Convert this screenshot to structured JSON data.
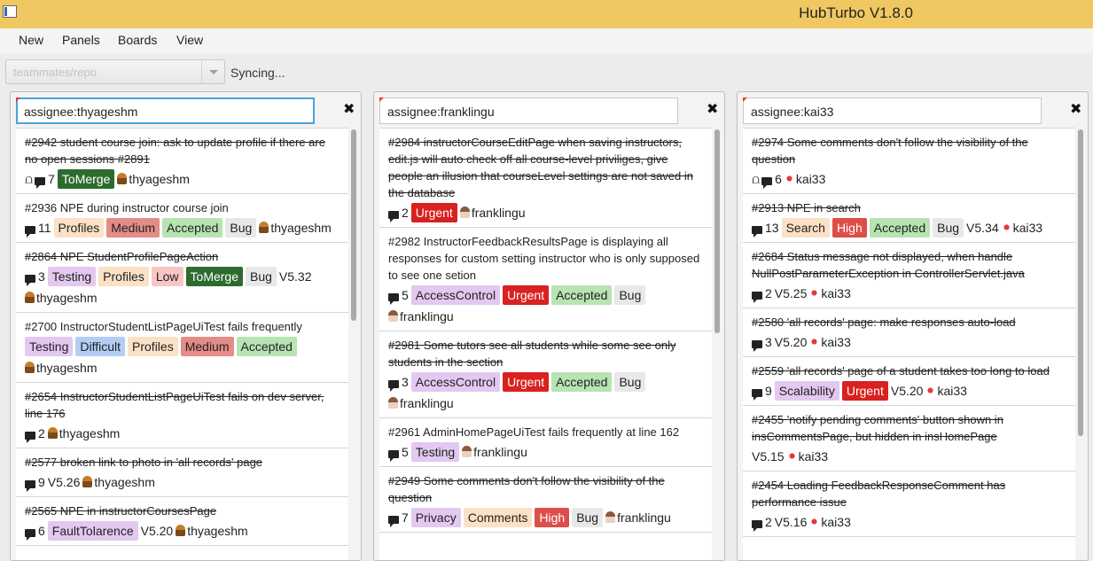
{
  "window": {
    "title": "HubTurbo V1.8.0"
  },
  "menu": [
    "New",
    "Panels",
    "Boards",
    "View"
  ],
  "toolbar": {
    "repo": "teammates/repo",
    "status": "Syncing..."
  },
  "colors": {
    "titlebar": "#f0c862",
    "focus": "#4aa3df"
  },
  "label_colors": {
    "ToMerge": {
      "bg": "#2e6b30",
      "fg": "#ffffff"
    },
    "Profiles": {
      "bg": "#fbe1c6",
      "fg": "#222222"
    },
    "Medium": {
      "bg": "#e38c88",
      "fg": "#222222"
    },
    "Accepted": {
      "bg": "#b8e3b3",
      "fg": "#222222"
    },
    "Bug": {
      "bg": "#e8e8e8",
      "fg": "#222222"
    },
    "Testing": {
      "bg": "#e3c8f0",
      "fg": "#222222"
    },
    "Low": {
      "bg": "#f7c6c4",
      "fg": "#222222"
    },
    "Difficult": {
      "bg": "#b4cdf5",
      "fg": "#222222"
    },
    "FaultTolarence": {
      "bg": "#e3c8f0",
      "fg": "#222222"
    },
    "Urgent": {
      "bg": "#d9211f",
      "fg": "#ffffff"
    },
    "AccessControl": {
      "bg": "#e3c8f0",
      "fg": "#222222"
    },
    "Privacy": {
      "bg": "#e3c8f0",
      "fg": "#222222"
    },
    "Comments": {
      "bg": "#fbe1c6",
      "fg": "#222222"
    },
    "High": {
      "bg": "#dd4e48",
      "fg": "#ffffff"
    },
    "Search": {
      "bg": "#fbe1c6",
      "fg": "#222222"
    },
    "Scalability": {
      "bg": "#e3c8f0",
      "fg": "#222222"
    }
  },
  "panels": [
    {
      "filter": "assignee:thyageshm",
      "focused": true,
      "scroll": {
        "start": 0.0,
        "end": 0.45
      },
      "issues": [
        {
          "title": "#2942 student course join: ask to update profile if there are no open sessions #2891",
          "closed": true,
          "pr": true,
          "comments": "7",
          "labels": [
            "ToMerge"
          ],
          "assignee": "thyageshm",
          "avatar": "a1"
        },
        {
          "title": "#2936 NPE during instructor course join",
          "closed": false,
          "comments": "11",
          "labels": [
            "Profiles",
            "Medium",
            "Accepted",
            "Bug"
          ],
          "assignee": "thyageshm",
          "avatar": "a1"
        },
        {
          "title": "#2864 NPE StudentProfilePageAction",
          "closed": true,
          "comments": "3",
          "labels": [
            "Testing",
            "Profiles",
            "Low",
            "ToMerge",
            "Bug"
          ],
          "milestone": "V5.32",
          "assignee": "thyageshm",
          "avatar": "a1"
        },
        {
          "title": "#2700 InstructorStudentListPageUiTest fails frequently",
          "closed": false,
          "labels": [
            "Testing",
            "Difficult",
            "Profiles",
            "Medium",
            "Accepted"
          ],
          "assignee": "thyageshm",
          "avatar": "a1"
        },
        {
          "title": "#2654 InstructorStudentListPageUiTest fails on dev server, line 176",
          "closed": true,
          "comments": "2",
          "labels": [],
          "assignee": "thyageshm",
          "avatar": "a1"
        },
        {
          "title": "#2577 broken link to photo in 'all records' page",
          "closed": true,
          "comments": "9",
          "labels": [],
          "milestone": "V5.26",
          "assignee": "thyageshm",
          "avatar": "a1"
        },
        {
          "title": "#2565 NPE in instructorCoursesPage",
          "closed": true,
          "comments": "6",
          "labels": [
            "FaultTolarence"
          ],
          "milestone": "V5.20",
          "assignee": "thyageshm",
          "avatar": "a1"
        }
      ]
    },
    {
      "filter": "assignee:franklingu",
      "focused": false,
      "scroll": {
        "start": 0.0,
        "end": 0.48
      },
      "issues": [
        {
          "title": "#2984 instructorCourseEditPage when saving instructors, edit.js will auto check off all course-level priviliges, give people an illusion that courseLevel settings are not saved in the database",
          "closed": true,
          "comments": "2",
          "labels": [
            "Urgent"
          ],
          "assignee": "franklingu",
          "avatar": "a2"
        },
        {
          "title": "#2982 InstructorFeedbackResultsPage is displaying all responses for custom setting instructor who is only supposed to see one setion",
          "closed": false,
          "comments": "5",
          "labels": [
            "AccessControl",
            "Urgent",
            "Accepted",
            "Bug"
          ],
          "assignee": "franklingu",
          "avatar": "a2"
        },
        {
          "title": "#2981 Some tutors see all students while some see only students in the section",
          "closed": true,
          "comments": "3",
          "labels": [
            "AccessControl",
            "Urgent",
            "Accepted",
            "Bug"
          ],
          "assignee": "franklingu",
          "avatar": "a2"
        },
        {
          "title": "#2961 AdminHomePageUiTest fails frequently at line 162",
          "closed": false,
          "comments": "5",
          "labels": [
            "Testing"
          ],
          "assignee": "franklingu",
          "avatar": "a2"
        },
        {
          "title": "#2949 Some comments don't follow the visibility of the question",
          "closed": true,
          "comments": "7",
          "labels": [
            "Privacy",
            "Comments",
            "High",
            "Bug"
          ],
          "assignee": "franklingu",
          "avatar": "a2"
        }
      ]
    },
    {
      "filter": "assignee:kai33",
      "focused": false,
      "scroll": {
        "start": 0.0,
        "end": 0.72
      },
      "issues": [
        {
          "title": "#2974 Some comments don't follow the visibility of the question",
          "closed": true,
          "pr": true,
          "comments": "6",
          "labels": [],
          "assignee": "kai33",
          "avatar": "a3"
        },
        {
          "title": "#2913 NPE in search",
          "closed": true,
          "comments": "13",
          "labels": [
            "Search",
            "High",
            "Accepted",
            "Bug"
          ],
          "milestone": "V5.34",
          "assignee": "kai33",
          "avatar": "a3"
        },
        {
          "title": "#2684 Status message not displayed, when handle NullPostParameterException in ControllerServlet.java",
          "closed": true,
          "comments": "2",
          "labels": [],
          "milestone": "V5.25",
          "assignee": "kai33",
          "avatar": "a3"
        },
        {
          "title": "#2580 'all records' page: make responses auto-load",
          "closed": true,
          "comments": "3",
          "labels": [],
          "milestone": "V5.20",
          "assignee": "kai33",
          "avatar": "a3"
        },
        {
          "title": "#2559 'all records' page of a student takes too long to load",
          "closed": true,
          "comments": "9",
          "labels": [
            "Scalability",
            "Urgent"
          ],
          "milestone": "V5.20",
          "assignee": "kai33",
          "avatar": "a3"
        },
        {
          "title": "#2455 'notify pending comments' button shown in insCommentsPage, but hidden in insHomePage",
          "closed": true,
          "labels": [],
          "milestone": "V5.15",
          "assignee": "kai33",
          "avatar": "a3"
        },
        {
          "title": "#2454 Loading FeedbackResponseComment has performance issue",
          "closed": true,
          "comments": "2",
          "labels": [],
          "milestone": "V5.16",
          "assignee": "kai33",
          "avatar": "a3"
        }
      ]
    }
  ]
}
